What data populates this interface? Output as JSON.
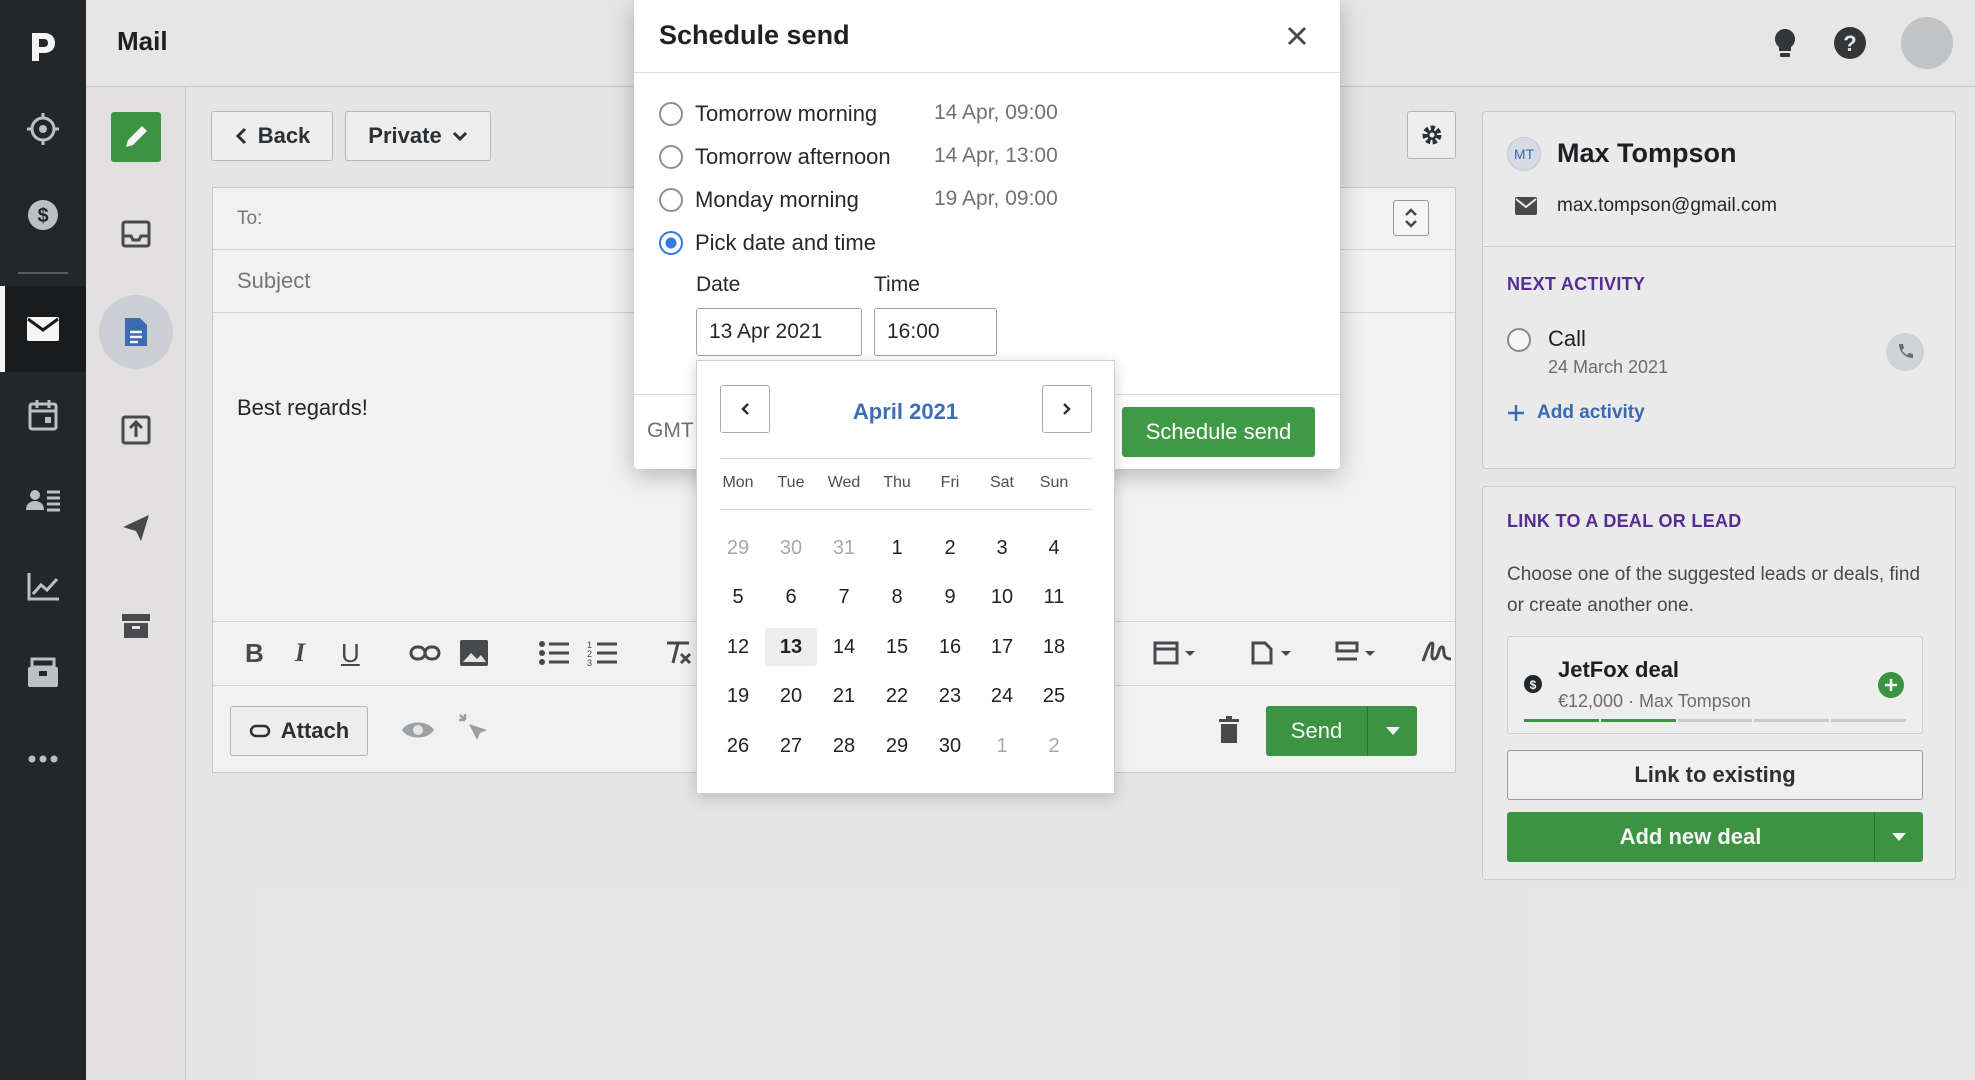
{
  "app": {
    "title": "Mail"
  },
  "compose": {
    "back_label": "Back",
    "visibility_label": "Private",
    "to_label": "To:",
    "subject_placeholder": "Subject",
    "body": "Best regards!",
    "attach_label": "Attach",
    "send_label": "Send"
  },
  "contact": {
    "initials": "MT",
    "name": "Max Tompson",
    "email": "max.tompson@gmail.com"
  },
  "next_activity": {
    "title": "NEXT ACTIVITY",
    "activity_name": "Call",
    "activity_date": "24 March 2021",
    "add_label": "Add activity"
  },
  "link_deal": {
    "title": "LINK TO A DEAL OR LEAD",
    "description": "Choose one of the suggested leads or deals, find or create another one.",
    "deal_name": "JetFox deal",
    "deal_meta": "€12,000 · Max Tompson",
    "link_existing_label": "Link to existing",
    "add_new_label": "Add new deal",
    "deal_progress_stages": 5,
    "deal_progress_completed": 2
  },
  "schedule_modal": {
    "title": "Schedule send",
    "options": [
      {
        "label": "Tomorrow morning",
        "date": "14 Apr, 09:00",
        "selected": false
      },
      {
        "label": "Tomorrow afternoon",
        "date": "14 Apr, 13:00",
        "selected": false
      },
      {
        "label": "Monday morning",
        "date": "19 Apr, 09:00",
        "selected": false
      },
      {
        "label": "Pick date and time",
        "date": "",
        "selected": true
      }
    ],
    "date_label": "Date",
    "date_value": "13 Apr 2021",
    "time_label": "Time",
    "time_value": "16:00",
    "timezone_partial": "GMT",
    "submit_label": "Schedule send"
  },
  "calendar": {
    "month": "April 2021",
    "weekdays": [
      "Mon",
      "Tue",
      "Wed",
      "Thu",
      "Fri",
      "Sat",
      "Sun"
    ],
    "weeks": [
      [
        {
          "d": "29",
          "m": true
        },
        {
          "d": "30",
          "m": true
        },
        {
          "d": "31",
          "m": true
        },
        {
          "d": "1"
        },
        {
          "d": "2"
        },
        {
          "d": "3"
        },
        {
          "d": "4"
        }
      ],
      [
        {
          "d": "5"
        },
        {
          "d": "6"
        },
        {
          "d": "7"
        },
        {
          "d": "8"
        },
        {
          "d": "9"
        },
        {
          "d": "10"
        },
        {
          "d": "11"
        }
      ],
      [
        {
          "d": "12"
        },
        {
          "d": "13",
          "today": true
        },
        {
          "d": "14"
        },
        {
          "d": "15"
        },
        {
          "d": "16"
        },
        {
          "d": "17"
        },
        {
          "d": "18"
        }
      ],
      [
        {
          "d": "19"
        },
        {
          "d": "20"
        },
        {
          "d": "21"
        },
        {
          "d": "22"
        },
        {
          "d": "23"
        },
        {
          "d": "24"
        },
        {
          "d": "25"
        }
      ],
      [
        {
          "d": "26"
        },
        {
          "d": "27"
        },
        {
          "d": "28"
        },
        {
          "d": "29"
        },
        {
          "d": "30"
        },
        {
          "d": "1",
          "m": true
        },
        {
          "d": "2",
          "m": true
        }
      ]
    ]
  },
  "colors": {
    "accent_green": "#3f9b46",
    "link_blue": "#3d6fb7",
    "rail_dark": "#26292c",
    "section_purple": "#5b2f9a"
  }
}
